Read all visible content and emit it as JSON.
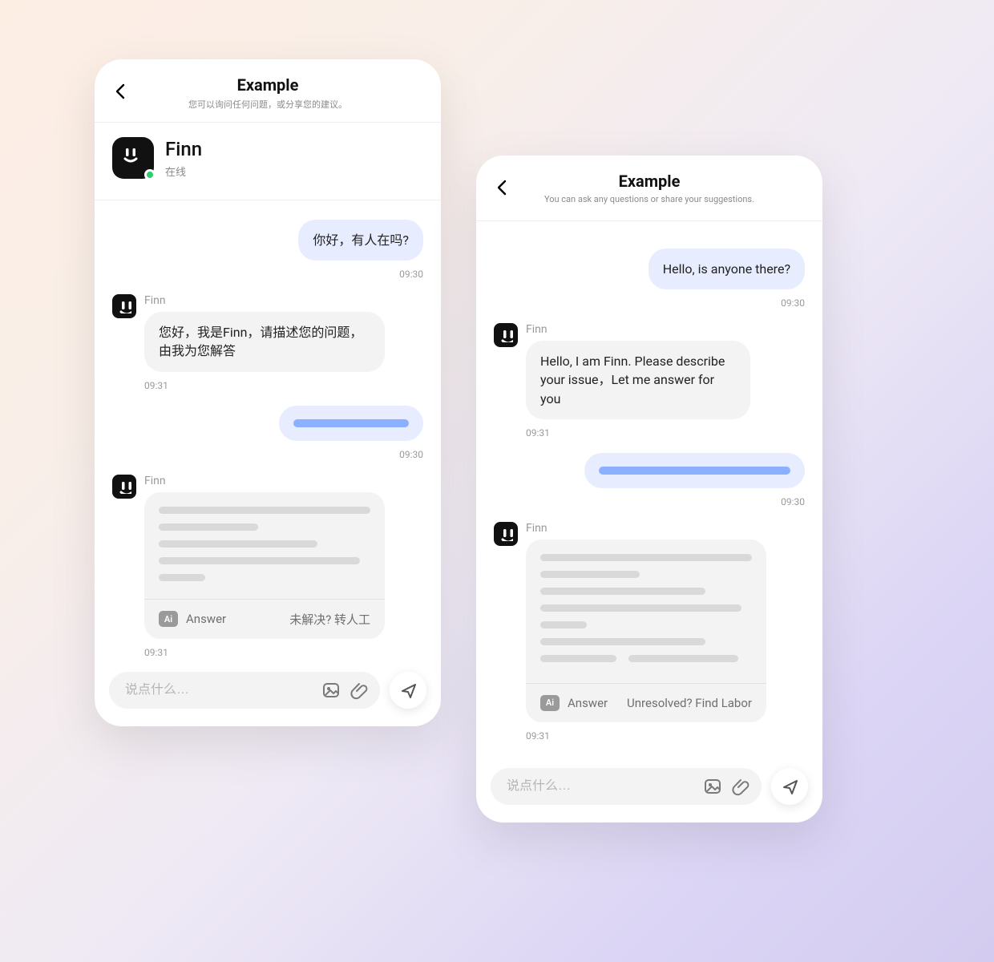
{
  "left": {
    "header": {
      "title": "Example",
      "subtitle": "您可以询问任何问题，或分享您的建议。"
    },
    "bot": {
      "name": "Finn",
      "presence": "在线"
    },
    "messages": {
      "m0": {
        "sender": "",
        "text": "你好，有人在吗?",
        "time": "09:30"
      },
      "m1": {
        "sender": "Finn",
        "text": "您好，我是Finn，请描述您的问题，由我为您解答",
        "time": "09:31"
      },
      "m2": {
        "time": "09:30"
      },
      "m3": {
        "sender": "Finn",
        "ai_label": "Ai",
        "answer": "Answer",
        "unresolved": "未解决?  转人工",
        "time": "09:31"
      }
    },
    "composer": {
      "placeholder": "说点什么…"
    }
  },
  "right": {
    "header": {
      "title": "Example",
      "subtitle": "You can ask any questions or share your suggestions."
    },
    "messages": {
      "m0": {
        "sender": "",
        "text": "Hello, is anyone there?",
        "time": "09:30"
      },
      "m1": {
        "sender": "Finn",
        "text": "Hello, I am Finn. Please describe your issue，Let me answer for you",
        "time": "09:31"
      },
      "m2": {
        "time": "09:30"
      },
      "m3": {
        "sender": "Finn",
        "ai_label": "Ai",
        "answer": "Answer",
        "unresolved": "Unresolved? Find Labor",
        "time": "09:31"
      }
    },
    "composer": {
      "placeholder": "说点什么…"
    }
  }
}
